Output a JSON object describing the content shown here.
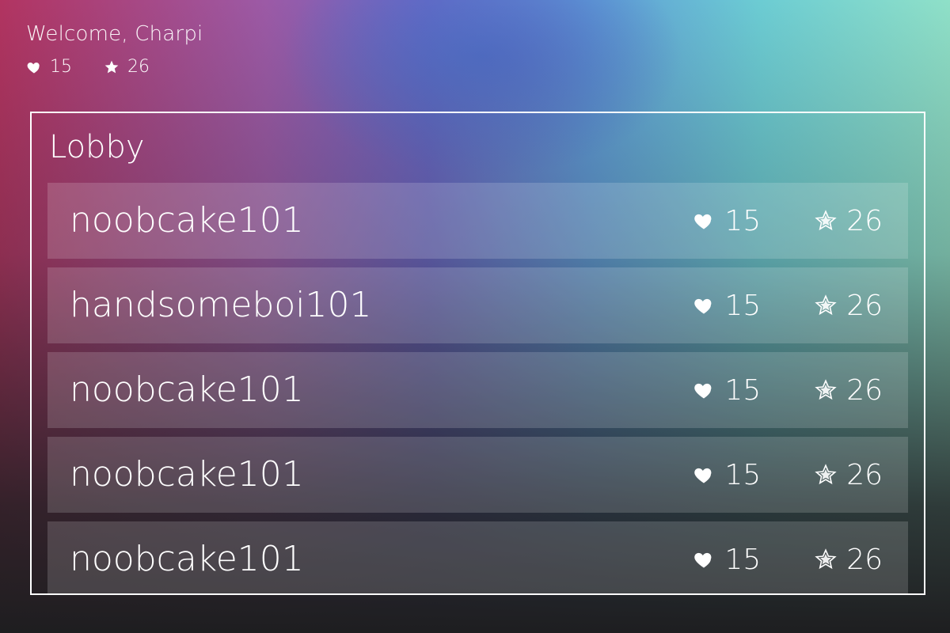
{
  "header": {
    "welcome": "Welcome, Charpi",
    "hearts": "15",
    "stars": "26",
    "icons": {
      "heart": "heart-icon",
      "star": "star-icon"
    }
  },
  "lobby": {
    "title": "Lobby",
    "players": [
      {
        "name": "noobcake101",
        "hearts": "15",
        "stars": "26"
      },
      {
        "name": "handsomeboi101",
        "hearts": "15",
        "stars": "26"
      },
      {
        "name": "noobcake101",
        "hearts": "15",
        "stars": "26"
      },
      {
        "name": "noobcake101",
        "hearts": "15",
        "stars": "26"
      },
      {
        "name": "noobcake101",
        "hearts": "15",
        "stars": "26"
      }
    ]
  },
  "colors": {
    "text": "#ffffff",
    "border": "#ffffff",
    "gradient_left": "#b23461",
    "gradient_mid": "#6a67c4",
    "gradient_right": "#8fe0c8",
    "gradient_bottom": "#1e1e20"
  }
}
